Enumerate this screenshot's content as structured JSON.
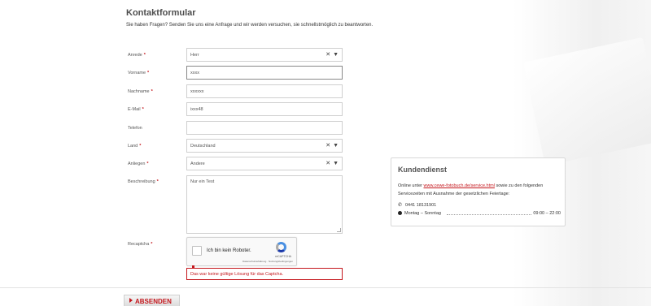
{
  "page": {
    "title": "Kontaktformular",
    "intro": "Sie haben Fragen? Senden Sie uns eine Anfrage und wir werden versuchen, sie schnellstmöglich zu beantworten."
  },
  "required_marker": "*",
  "form": {
    "anrede": {
      "label": "Anrede",
      "value": "Herr"
    },
    "vorname": {
      "label": "Vorname",
      "value": "xxxx"
    },
    "nachname": {
      "label": "Nachname",
      "value": "xxxxxx"
    },
    "email": {
      "label": "E-Mail",
      "value": "ixxx48"
    },
    "telefon": {
      "label": "Telefon",
      "value": ""
    },
    "land": {
      "label": "Land",
      "value": "Deutschland"
    },
    "anliegen": {
      "label": "Anliegen",
      "value": "Andere"
    },
    "beschreibung": {
      "label": "Beschreibung",
      "value": "Nur ein Test"
    },
    "recaptcha": {
      "label": "Recaptcha",
      "checkbox_text": "Ich bin kein Roboter.",
      "brand": "reCAPTCHA",
      "terms": "Datenschutzerklärung · Nutzungsbedingungen"
    },
    "error": "Das war keine gültige Lösung für das Captcha.",
    "submit_label": "ABSENDEN"
  },
  "select_controls": {
    "clear": "✕",
    "arrow": "▼"
  },
  "service": {
    "title": "Kundendienst",
    "text_before": "Online unter ",
    "link": "www.cewe-fotobuch.de/service.html",
    "text_after": " sowie zu den folgenden Servicezeiten mit Ausnahme der gesetzlichen Feiertage:",
    "phone": "0441 18131901",
    "days": "Montag – Sonntag",
    "hours": "09:00 – 22:00"
  },
  "icons": {
    "phone": "phone-icon",
    "clock": "clock-icon"
  },
  "colors": {
    "accent": "#c4161c"
  }
}
